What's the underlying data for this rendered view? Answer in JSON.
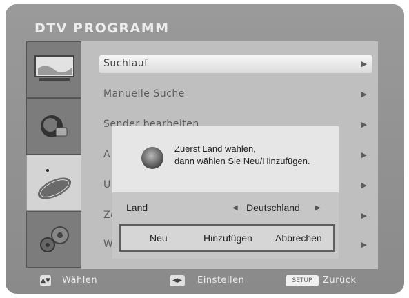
{
  "screen_title": "DTV PROGRAMM",
  "menu": {
    "items": [
      {
        "label": "Suchlauf",
        "selected": true
      },
      {
        "label": "Manuelle Suche"
      },
      {
        "label": "Sender bearbeiten"
      },
      {
        "label": "A"
      },
      {
        "label": "U"
      },
      {
        "label": "Ze"
      },
      {
        "label": "W"
      }
    ],
    "arrow": "▶"
  },
  "dialog": {
    "message_line1": "Zuerst Land wählen,",
    "message_line2": "dann wählen Sie Neu/Hinzufügen.",
    "land_label": "Land",
    "land_value": "Deutschland",
    "left_arrow": "◀",
    "right_arrow": "▶",
    "buttons": [
      "Neu",
      "Hinzufügen",
      "Abbrechen"
    ]
  },
  "footer": {
    "select_key": "▲▼",
    "select_label": "Wählen",
    "adjust_key": "◀▶",
    "adjust_label": "Einstellen",
    "setup_key": "SETUP",
    "back_label": "Zurück"
  },
  "tabs": [
    "tv-tab",
    "globe-tab",
    "satellite-tab",
    "settings-tab"
  ]
}
